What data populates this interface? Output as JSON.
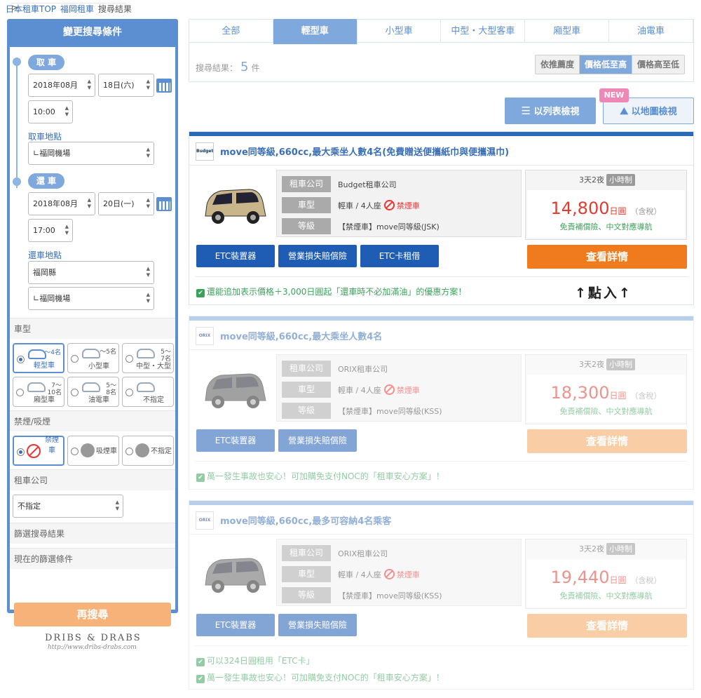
{
  "breadcrumb": {
    "home": "日本租車TOP",
    "sep": ">",
    "region": "福岡租車",
    "current": "搜尋結果"
  },
  "sidebar": {
    "title": "變更搜尋條件",
    "pickup": {
      "label": "取 車",
      "month": "2018年08月",
      "day": "18日(六)",
      "time": "10:00",
      "location_label": "取車地點",
      "location": "∟福岡機場"
    },
    "dropoff": {
      "label": "還 車",
      "month": "2018年08月",
      "day": "20日(一)",
      "time": "17:00",
      "location_label": "還車地點",
      "prefecture": "福岡縣",
      "location": "∟福岡機場"
    },
    "car_type_label": "車型",
    "car_types": [
      {
        "label": "輕型車",
        "count": "～4名",
        "selected": true
      },
      {
        "label": "小型車",
        "count": "～5名",
        "selected": false
      },
      {
        "label": "中型・大型",
        "count": "5～\n7名",
        "selected": false
      },
      {
        "label": "廂型車",
        "count": "7～\n10名",
        "selected": false
      },
      {
        "label": "油電車",
        "count": "5～\n8名",
        "selected": false
      },
      {
        "label": "不指定",
        "count": "",
        "selected": false
      }
    ],
    "smoking_label": "禁煙/吸煙",
    "smoking": [
      {
        "label": "禁煙車",
        "selected": true
      },
      {
        "label": "吸煙車",
        "selected": false
      },
      {
        "label": "不指定",
        "selected": false
      }
    ],
    "company_label": "租車公司",
    "company_value": "不指定",
    "filter_label": "篩選搜尋結果",
    "current_filter_label": "現在的篩選條件",
    "search_button": "再搜尋"
  },
  "watermark": {
    "line1": "DRIBS & DRABS",
    "line2": "http://www.dribs-drabs.com"
  },
  "tabs": [
    {
      "label": "全部",
      "active": false
    },
    {
      "label": "輕型車",
      "active": true
    },
    {
      "label": "小型車",
      "active": false
    },
    {
      "label": "中型・大型客車",
      "active": false
    },
    {
      "label": "廂型車",
      "active": false
    },
    {
      "label": "油電車",
      "active": false
    }
  ],
  "results": {
    "label": "搜尋結果：",
    "count": "5",
    "unit": "件"
  },
  "sort": [
    {
      "label": "依推薦度",
      "active": false
    },
    {
      "label": "價格低至高",
      "active": true
    },
    {
      "label": "價格高至低",
      "active": false
    }
  ],
  "view": {
    "list": "以列表檢視",
    "map": "以地圖檢視",
    "new_badge": "NEW"
  },
  "cards": [
    {
      "logo": "Budget",
      "title": "move同等級,660cc,最大乘坐人數4名(免費贈送便攜紙巾與便攜濕巾)",
      "company_key": "租車公司",
      "company": "Budget租車公司",
      "type_key": "車型",
      "type": "輕車 / 4人座",
      "smoke": "禁煙車",
      "class_key": "等級",
      "class": "【禁煙車】move同等級(JSK)",
      "duration": "3天2夜",
      "hourly": "小時制",
      "price": "14,800",
      "currency": "日圓",
      "tax": "（含稅）",
      "free": "免責補償險、中文對應導航",
      "tags": [
        "ETC裝置器",
        "營業損失賠償險",
        "ETC卡租借"
      ],
      "detail": "查看詳情",
      "notes": [
        "還能追加表示價格＋3,000日圓起「還車時不必加滿油」的優惠方案！"
      ]
    },
    {
      "logo": "ORIX",
      "title": "move同等級,660cc,最大乘坐人數4名",
      "company_key": "租車公司",
      "company": "ORIX租車公司",
      "type_key": "車型",
      "type": "輕車 / 4人座",
      "smoke": "禁煙車",
      "class_key": "等級",
      "class": "【禁煙車】move同等級(KSS)",
      "duration": "3天2夜",
      "hourly": "小時制",
      "price": "18,300",
      "currency": "日圓",
      "tax": "（含稅）",
      "free": "免責補償險、中文對應導航",
      "tags": [
        "ETC裝置器",
        "營業損失賠償險"
      ],
      "detail": "查看詳情",
      "notes": [
        "萬一發生事故也安心！可加購免支付NOC的「租車安心方案」！"
      ]
    },
    {
      "logo": "ORIX",
      "title": "move同等級,660cc,最多可容納4名乘客",
      "company_key": "租車公司",
      "company": "ORIX租車公司",
      "type_key": "車型",
      "type": "輕車 / 4人座",
      "smoke": "禁煙車",
      "class_key": "等級",
      "class": "【禁煙車】move同等級(KSS)",
      "duration": "3天2夜",
      "hourly": "小時制",
      "price": "19,440",
      "currency": "日圓",
      "tax": "（含稅）",
      "free": "免責補償險、中文對應導航",
      "tags": [
        "ETC裝置器",
        "營業損失賠償險"
      ],
      "detail": "查看詳情",
      "notes": [
        "可以324日圓租用「ETC卡」",
        "萬一發生事故也安心！可加購免支付NOC的「租車安心方案」！"
      ]
    }
  ],
  "annotation": "↑點入↑",
  "colors": {
    "accent": "#5b8fd2",
    "title_blue": "#2c68b8",
    "orange": "#f07a1e",
    "price_red": "#e03c31",
    "green": "#3aa35a"
  }
}
